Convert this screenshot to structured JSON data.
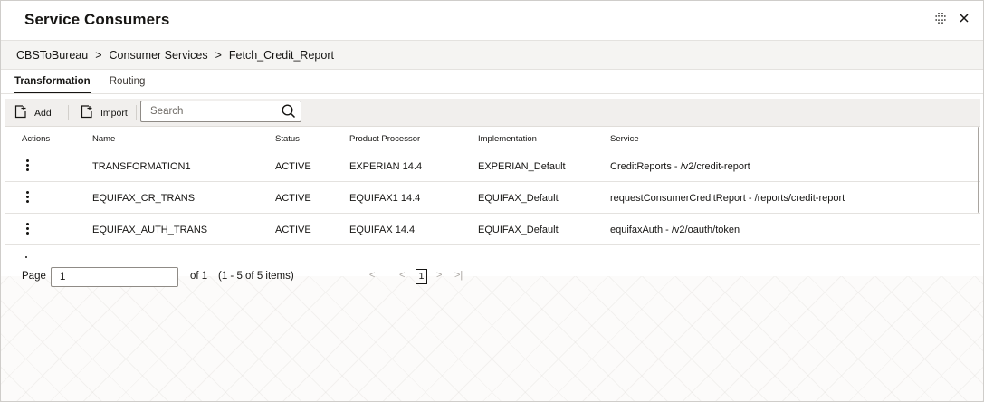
{
  "header": {
    "title": "Service Consumers",
    "icons": [
      "compress-icon",
      "close-icon"
    ]
  },
  "breadcrumb": {
    "items": [
      "CBSToBureau",
      "Consumer Services",
      "Fetch_Credit_Report"
    ],
    "separator": ">"
  },
  "tabs": [
    {
      "label": "Transformation",
      "active": true
    },
    {
      "label": "Routing",
      "active": false
    }
  ],
  "toolbar": {
    "add_label": "Add",
    "import_label": "Import",
    "search_placeholder": "Search",
    "search_value": ""
  },
  "table": {
    "columns": [
      "Actions",
      "Name",
      "Status",
      "Product Processor",
      "Implementation",
      "Service"
    ],
    "rows": [
      {
        "name": "TRANSFORMATION1",
        "status": "ACTIVE",
        "processor": "EXPERIAN 14.4",
        "implementation": "EXPERIAN_Default",
        "service": "CreditReports - /v2/credit-report"
      },
      {
        "name": "EQUIFAX_CR_TRANS",
        "status": "ACTIVE",
        "processor": "EQUIFAX1 14.4",
        "implementation": "EQUIFAX_Default",
        "service": "requestConsumerCreditReport - /reports/credit-report"
      },
      {
        "name": "EQUIFAX_AUTH_TRANS",
        "status": "ACTIVE",
        "processor": "EQUIFAX 14.4",
        "implementation": "EQUIFAX_Default",
        "service": "equifaxAuth - /v2/oauth/token"
      }
    ]
  },
  "pagination": {
    "page_label": "Page",
    "page_value": "1",
    "of_text": "of 1",
    "range_text": "(1 - 5 of 5 items)",
    "current_page": "1",
    "nav": {
      "first": "|<",
      "prev": "<",
      "next": ">",
      "last": ">|"
    }
  },
  "colors": {
    "text": "#161513",
    "breadcrumb_bg": "#f5f4f2",
    "toolbar_bg": "#f1efed",
    "border": "#e4e2df"
  }
}
